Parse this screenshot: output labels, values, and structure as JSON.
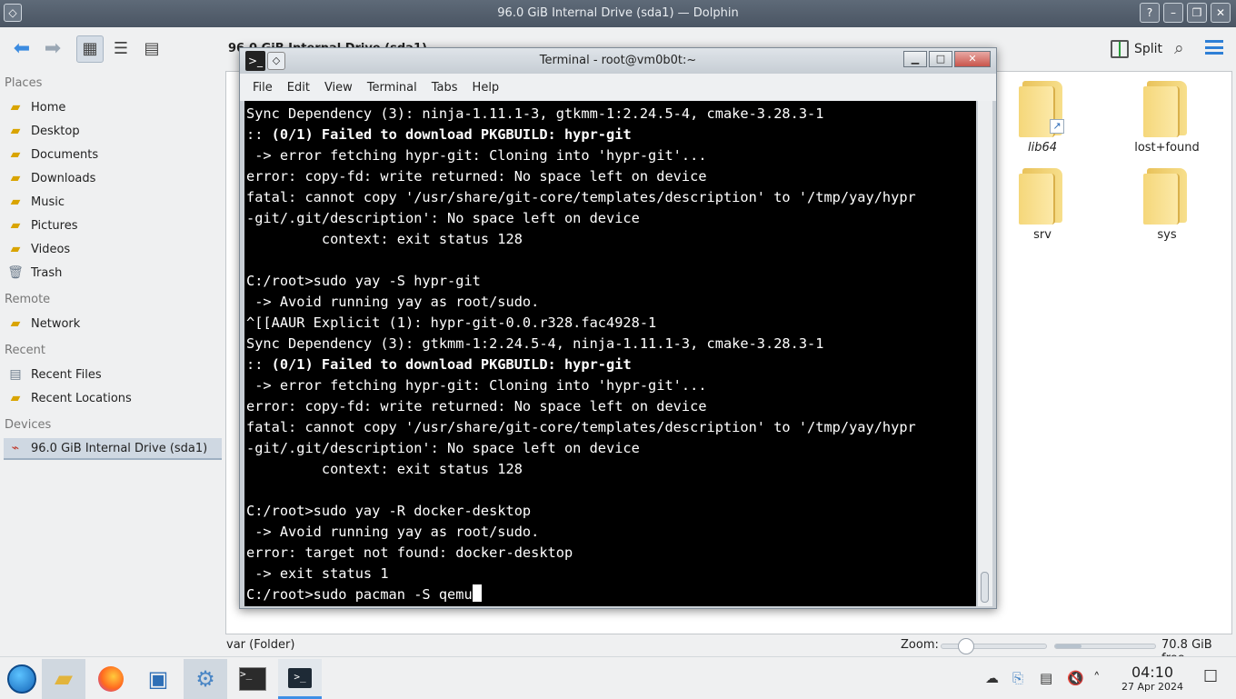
{
  "dolphin": {
    "title": "96.0 GiB Internal Drive (sda1) — Dolphin",
    "breadcrumb": "96.0 GiB Internal Drive (sda1)",
    "split_label": "Split",
    "places": {
      "places_header": "Places",
      "items": [
        "Home",
        "Desktop",
        "Documents",
        "Downloads",
        "Music",
        "Pictures",
        "Videos",
        "Trash"
      ],
      "remote_header": "Remote",
      "remote_items": [
        "Network"
      ],
      "recent_header": "Recent",
      "recent_items": [
        "Recent Files",
        "Recent Locations"
      ],
      "devices_header": "Devices",
      "device_items": [
        "96.0 GiB Internal Drive (sda1)"
      ]
    },
    "folders": [
      "lib64",
      "lost+found",
      "srv",
      "sys"
    ],
    "status_text": "var (Folder)",
    "zoom_label": "Zoom:",
    "zoom_level": 0.24,
    "free_space": "70.8 GiB free",
    "used_fraction": 0.26
  },
  "terminal": {
    "title": "Terminal - root@vm0b0t:~",
    "menu": [
      "File",
      "Edit",
      "View",
      "Terminal",
      "Tabs",
      "Help"
    ],
    "lines": [
      "Sync Dependency (3): ninja-1.11.1-3, gtkmm-1:2.24.5-4, cmake-3.28.3-1",
      ":: |(0/1) Failed to download PKGBUILD: hypr-git",
      " -> error fetching hypr-git: Cloning into 'hypr-git'...",
      "error: copy-fd: write returned: No space left on device",
      "fatal: cannot copy '/usr/share/git-core/templates/description' to '/tmp/yay/hypr",
      "-git/.git/description': No space left on device",
      "         context: exit status 128",
      "",
      "C:/root>sudo yay -S hypr-git",
      " -> Avoid running yay as root/sudo.",
      "^[[AAUR Explicit (1): hypr-git-0.0.r328.fac4928-1",
      "Sync Dependency (3): gtkmm-1:2.24.5-4, ninja-1.11.1-3, cmake-3.28.3-1",
      ":: |(0/1) Failed to download PKGBUILD: hypr-git",
      " -> error fetching hypr-git: Cloning into 'hypr-git'...",
      "error: copy-fd: write returned: No space left on device",
      "fatal: cannot copy '/usr/share/git-core/templates/description' to '/tmp/yay/hypr",
      "-git/.git/description': No space left on device",
      "         context: exit status 128",
      "",
      "C:/root>sudo yay -R docker-desktop",
      " -> Avoid running yay as root/sudo.",
      "error: target not found: docker-desktop",
      " -> exit status 1",
      "C:/root>sudo pacman -S qemu"
    ]
  },
  "taskbar": {
    "time": "04:10",
    "date": "27 Apr 2024"
  },
  "colors": {
    "accent": "#3d8fe6",
    "terminal_bg": "#000000",
    "terminal_fg": "#ffffff"
  }
}
